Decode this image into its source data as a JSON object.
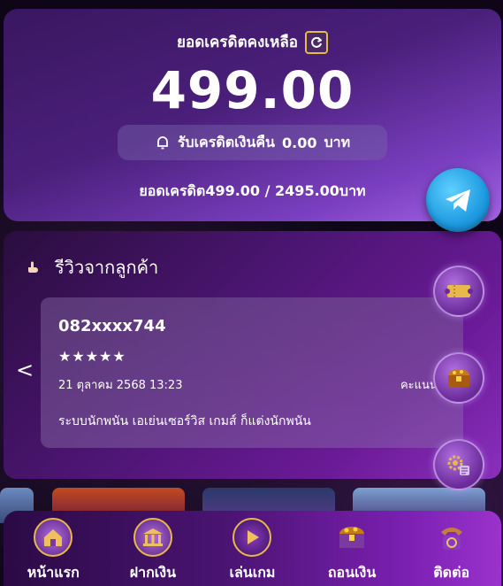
{
  "balance": {
    "label": "ยอดเครดิตคงเหลือ",
    "amount": "499.00",
    "cashback_label": "รับเครดิตเงินคืน",
    "cashback_amount": "0.00",
    "cashback_currency": "บาท",
    "summary": "ยอดเครดิต499.00 / 2495.00บาท"
  },
  "reviews": {
    "title": "รีวิวจากลูกค้า",
    "prev_arrow": "<",
    "items": [
      {
        "phone": "082xxxx744",
        "stars": "★★★★★",
        "date": "21 ตุลาคม 2568 13:23",
        "score_label": "คะแนน (",
        "text": "ระบบนักพนัน เอเย่นเซอร์วิส เกมส์ ก็แต่งนักพนัน"
      }
    ]
  },
  "nav": {
    "items": [
      {
        "label": "หน้าแรก",
        "icon": "home-icon"
      },
      {
        "label": "ฝากเงิน",
        "icon": "bank-icon"
      },
      {
        "label": "เล่นเกม",
        "icon": "play-icon"
      },
      {
        "label": "ถอนเงิน",
        "icon": "treasure-chest-icon"
      },
      {
        "label": "ติดต่อ",
        "icon": "telephone-icon"
      }
    ]
  },
  "colors": {
    "accent_gold": "#e9b84a",
    "telegram_blue": "#1e9ae0"
  }
}
